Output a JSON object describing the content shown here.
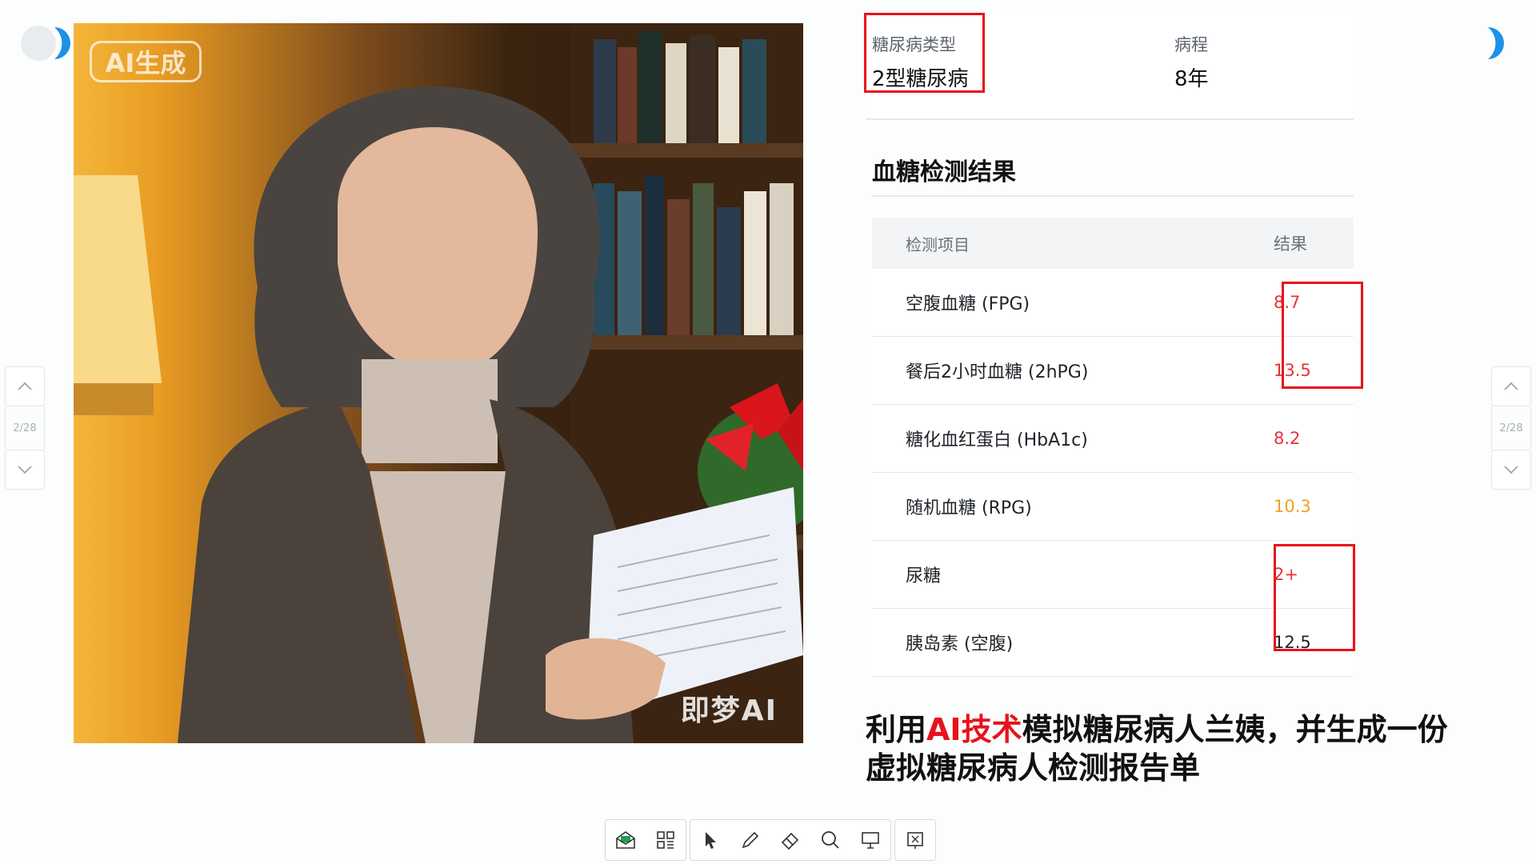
{
  "corner_toggles": {
    "left_icon": "moon-toggle-icon",
    "right_icon": "moon-toggle-icon"
  },
  "side_nav": {
    "page_indicator": "2/28",
    "up_icon": "chevron-up-icon",
    "down_icon": "chevron-down-icon"
  },
  "photo": {
    "ai_badge": "AI生成",
    "watermark": "即梦AI"
  },
  "patient_info": {
    "type_label": "糖尿病类型",
    "type_value": "2型糖尿病",
    "course_label": "病程",
    "course_value": "8年"
  },
  "lab": {
    "title": "血糖检测结果",
    "header": {
      "item": "检测项目",
      "result": "结果"
    },
    "rows": [
      {
        "name": "空腹血糖 (FPG)",
        "value": "8.7",
        "color": "#e8313a"
      },
      {
        "name": "餐后2小时血糖 (2hPG)",
        "value": "13.5",
        "color": "#e8313a"
      },
      {
        "name": "糖化血红蛋白 (HbA1c)",
        "value": "8.2",
        "color": "#e8313a"
      },
      {
        "name": "随机血糖 (RPG)",
        "value": "10.3",
        "color": "#f0a020"
      },
      {
        "name": "尿糖",
        "value": "2+",
        "color": "#e8313a"
      },
      {
        "name": "胰岛素 (空腹)",
        "value": "12.5",
        "color": "#1f2329"
      }
    ]
  },
  "caption": {
    "part1": "利用",
    "highlight": "AI技术",
    "part2": "模拟糖尿病人兰姨，并生成一份虚拟糖尿病人检测报告单"
  },
  "toolbar": {
    "icons": [
      "envelope-icon",
      "qr-grid-icon",
      "pointer-icon",
      "pen-icon",
      "eraser-icon",
      "search-icon",
      "presentation-icon",
      "screen-icon"
    ]
  },
  "colors": {
    "accent_red": "#e8121b",
    "toggle_blue": "#1e90e8"
  }
}
